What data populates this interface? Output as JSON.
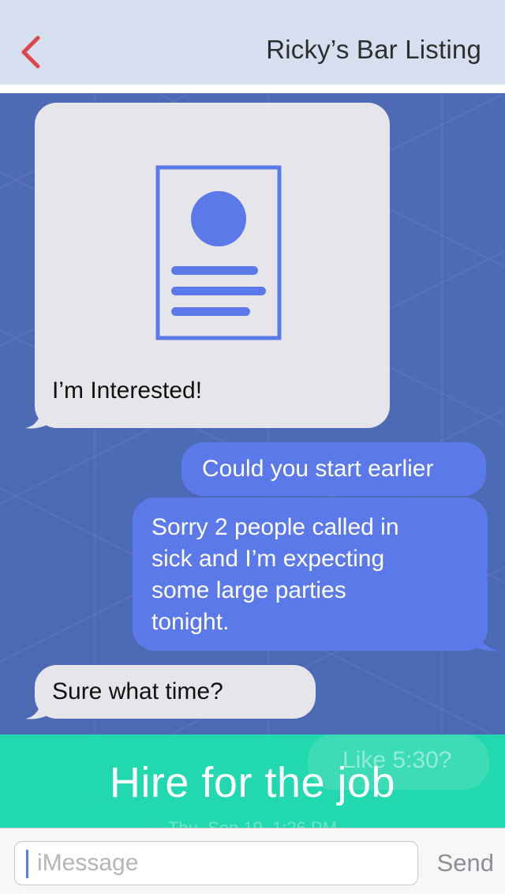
{
  "header": {
    "title": "Ricky’s Bar Listing",
    "back_icon": "chevron-left-icon",
    "accent_color": "#e0454c"
  },
  "messages": [
    {
      "from": "them",
      "type": "card",
      "icon": "document-profile-icon",
      "text": "I’m Interested!"
    },
    {
      "from": "me",
      "text": "Could you start earlier"
    },
    {
      "from": "me",
      "lines": [
        "Sorry 2 people called in",
        "sick and I’m expecting",
        "some large parties",
        "tonight."
      ]
    },
    {
      "from": "them",
      "text": "Sure what time?"
    },
    {
      "from": "me",
      "text": "Like 5:30?",
      "partially_obscured": true
    }
  ],
  "timestamp": "Thu, Sep 19, 1:26 PM",
  "cta": {
    "label": "Hire for the job",
    "color": "#22d8ae"
  },
  "composer": {
    "placeholder": "iMessage",
    "send_label": "Send"
  },
  "colors": {
    "header_bg": "#d5dff0",
    "chat_bg": "#4e6ab4",
    "outgoing_bubble": "#5b79e8",
    "incoming_bubble": "#e5e5ea"
  }
}
